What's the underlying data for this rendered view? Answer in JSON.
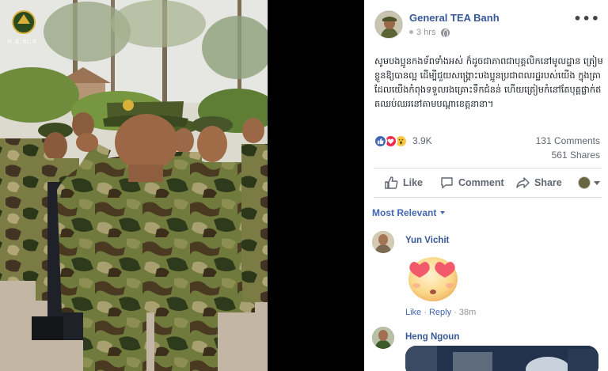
{
  "photo": {
    "watermark_text": "ក.ជ.ស.ភ."
  },
  "post": {
    "author": "General TEA Banh",
    "time": "3 hrs",
    "more_icon": "ellipsis-icon",
    "text": "សូមបងប្អូនកងទ័ពទាំងអស់ ក៏ដូចជាភាពជាបុគ្គលិកនៅមូលដ្ឋាន ត្រៀមខ្លួនឱ្យបានល្អ ដើម្បីជួយសង្គ្រោះបងប្អូនប្រជាពលរដ្ឋរបស់យើង ក្នុងគ្រាដែលយើងកំពុងទទួលរងគ្រោះទឹកជំនន់ ហើយត្រៀមកំនៅតែបុគ្គផ្លាក់ឥតឈប់ឈរនៅតាមបណ្ដាខេត្តនានា។",
    "reaction_count": "3.9K",
    "comments_count": "131 Comments",
    "shares_count": "561 Shares"
  },
  "actions": {
    "like": "Like",
    "comment": "Comment",
    "share": "Share"
  },
  "comments_filter": "Most Relevant",
  "comments": [
    {
      "name": "Yun Vichit",
      "like": "Like",
      "reply": "Reply",
      "time": "38m",
      "sticker": "heart-eyes-sticker"
    },
    {
      "name": "Heng Ngoun"
    }
  ],
  "colors": {
    "link_blue": "#385898",
    "accent_blue": "#4267b2",
    "muted_gray": "#90949c",
    "love_red": "#f0284a",
    "wow_yellow": "#f7c846"
  }
}
